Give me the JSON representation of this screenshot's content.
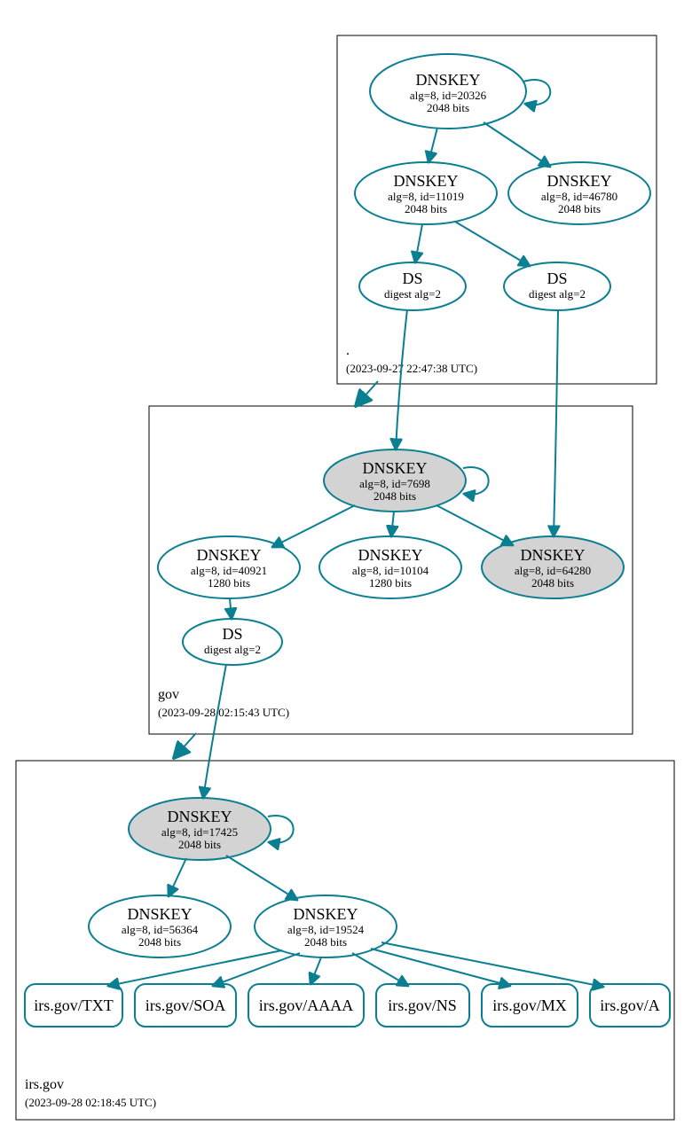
{
  "zones": [
    {
      "id": "root",
      "label": ".",
      "timestamp": "(2023-09-27 22:47:38 UTC)",
      "nodes": {
        "k20326": {
          "l1": "DNSKEY",
          "l2": "alg=8, id=20326",
          "l3": "2048 bits"
        },
        "k11019": {
          "l1": "DNSKEY",
          "l2": "alg=8, id=11019",
          "l3": "2048 bits"
        },
        "k46780": {
          "l1": "DNSKEY",
          "l2": "alg=8, id=46780",
          "l3": "2048 bits"
        },
        "dsL": {
          "l1": "DS",
          "l2": "digest alg=2"
        },
        "dsR": {
          "l1": "DS",
          "l2": "digest alg=2"
        }
      }
    },
    {
      "id": "gov",
      "label": "gov",
      "timestamp": "(2023-09-28 02:15:43 UTC)",
      "nodes": {
        "k7698": {
          "l1": "DNSKEY",
          "l2": "alg=8, id=7698",
          "l3": "2048 bits"
        },
        "k40921": {
          "l1": "DNSKEY",
          "l2": "alg=8, id=40921",
          "l3": "1280 bits"
        },
        "k10104": {
          "l1": "DNSKEY",
          "l2": "alg=8, id=10104",
          "l3": "1280 bits"
        },
        "k64280": {
          "l1": "DNSKEY",
          "l2": "alg=8, id=64280",
          "l3": "2048 bits"
        },
        "dsGov": {
          "l1": "DS",
          "l2": "digest alg=2"
        }
      }
    },
    {
      "id": "irsgov",
      "label": "irs.gov",
      "timestamp": "(2023-09-28 02:18:45 UTC)",
      "nodes": {
        "k17425": {
          "l1": "DNSKEY",
          "l2": "alg=8, id=17425",
          "l3": "2048 bits"
        },
        "k56364": {
          "l1": "DNSKEY",
          "l2": "alg=8, id=56364",
          "l3": "2048 bits"
        },
        "k19524": {
          "l1": "DNSKEY",
          "l2": "alg=8, id=19524",
          "l3": "2048 bits"
        }
      },
      "records": {
        "txt": {
          "label": "irs.gov/TXT"
        },
        "soa": {
          "label": "irs.gov/SOA"
        },
        "aaaa": {
          "label": "irs.gov/AAAA"
        },
        "ns": {
          "label": "irs.gov/NS"
        },
        "mx": {
          "label": "irs.gov/MX"
        },
        "a": {
          "label": "irs.gov/A"
        }
      }
    }
  ]
}
